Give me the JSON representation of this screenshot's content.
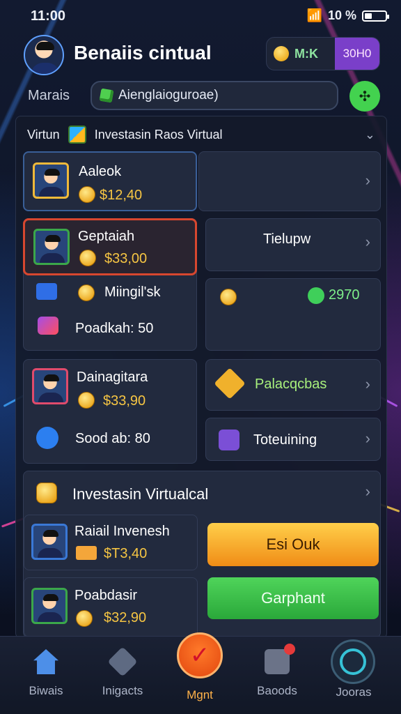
{
  "status": {
    "time": "11:00",
    "battery": "10 %"
  },
  "header": {
    "title": "Benaiis cintual",
    "wallet_label": "M:K",
    "wallet_amount": "30H0"
  },
  "search": {
    "label": "Marais",
    "value": "Aienglaioguroae)"
  },
  "panel": {
    "prefix": "Virtun",
    "title": "Investasin Raos Virtual"
  },
  "cards": {
    "a": {
      "name": "Aaleok",
      "money": "$12,40"
    },
    "b": {
      "name": "Geptaiah",
      "money": "$33,00",
      "line2": "Miingil'sk",
      "line3": "Poadkah: 50"
    },
    "c": {
      "title": "Tielupw",
      "value": "2970"
    },
    "d": {
      "name": "Dainagitara",
      "money": "$33,90",
      "line2": "Sood ab: 80"
    },
    "e": {
      "label": "Palacqcbas"
    },
    "f": {
      "label": "Toteuining"
    }
  },
  "section": {
    "title": "Investasin Virtualcal"
  },
  "invest": [
    {
      "name": "Raiail  Invenesh",
      "money": "$T3,40"
    },
    {
      "name": "Poabdasir",
      "money": "$32,90"
    }
  ],
  "buttons": {
    "primary": "Esi Ouk",
    "secondary": "Garphant"
  },
  "tabs": [
    "Biwais",
    "Inigacts",
    "Mgnt",
    "Baoods",
    "Jooras"
  ]
}
